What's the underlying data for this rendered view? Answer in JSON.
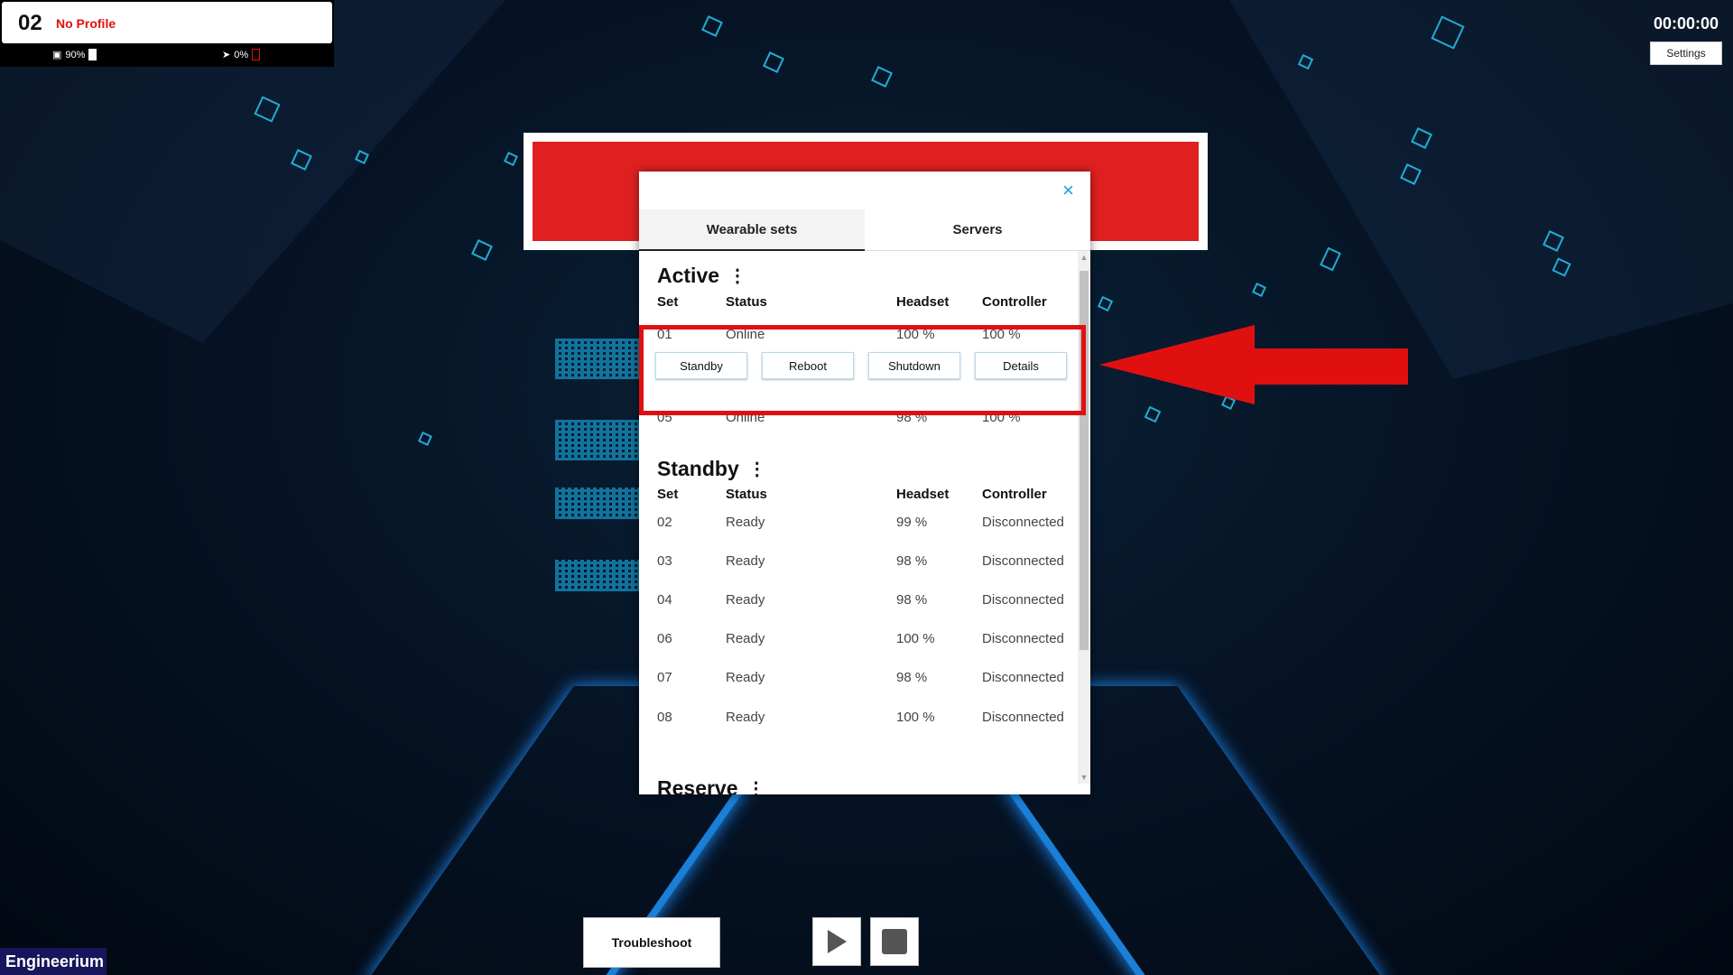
{
  "profile": {
    "number": "02",
    "name": "No Profile",
    "headset_battery": "90%",
    "controller_battery": "0%"
  },
  "timer": "00:00:00",
  "settings_label": "Settings",
  "modal": {
    "close_icon": "×",
    "tabs": [
      {
        "label": "Wearable sets",
        "active": true
      },
      {
        "label": "Servers",
        "active": false
      }
    ],
    "columns": {
      "set": "Set",
      "status": "Status",
      "headset": "Headset",
      "controller": "Controller"
    },
    "active": {
      "title": "Active",
      "rows": [
        {
          "set": "01",
          "status": "Online",
          "headset": "100 %",
          "controller": "100 %"
        },
        {
          "set": "05",
          "status": "Online",
          "headset": "98 %",
          "controller": "100 %"
        }
      ],
      "actions": [
        "Standby",
        "Reboot",
        "Shutdown",
        "Details"
      ]
    },
    "standby": {
      "title": "Standby",
      "rows": [
        {
          "set": "02",
          "status": "Ready",
          "headset": "99 %",
          "controller": "Disconnected"
        },
        {
          "set": "03",
          "status": "Ready",
          "headset": "98 %",
          "controller": "Disconnected"
        },
        {
          "set": "04",
          "status": "Ready",
          "headset": "98 %",
          "controller": "Disconnected"
        },
        {
          "set": "06",
          "status": "Ready",
          "headset": "100 %",
          "controller": "Disconnected"
        },
        {
          "set": "07",
          "status": "Ready",
          "headset": "98 %",
          "controller": "Disconnected"
        },
        {
          "set": "08",
          "status": "Ready",
          "headset": "100 %",
          "controller": "Disconnected"
        }
      ]
    },
    "reserve": {
      "title": "Reserve"
    }
  },
  "bottom": {
    "troubleshoot_label": "Troubleshoot",
    "brand": "Engineerium"
  },
  "colors": {
    "accent_red": "#e01010",
    "accent_blue": "#1a9fd8",
    "track_blue": "#1a7fd6"
  }
}
